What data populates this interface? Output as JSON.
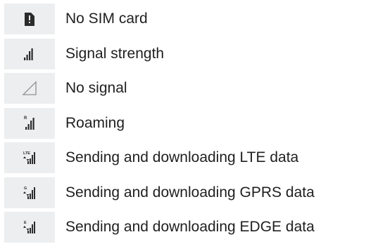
{
  "status_icons": [
    {
      "icon": "no-sim-card-icon",
      "label": "No SIM card"
    },
    {
      "icon": "signal-strength-icon",
      "label": "Signal strength"
    },
    {
      "icon": "no-signal-icon",
      "label": "No signal"
    },
    {
      "icon": "roaming-icon",
      "label": "Roaming",
      "badge": "R"
    },
    {
      "icon": "lte-data-icon",
      "label": "Sending and downloading LTE data",
      "badge": "LTE"
    },
    {
      "icon": "gprs-data-icon",
      "label": "Sending and downloading GPRS data",
      "badge": "G"
    },
    {
      "icon": "edge-data-icon",
      "label": "Sending and downloading EDGE data",
      "badge": "E"
    }
  ],
  "colors": {
    "icon_background": "#eceeef",
    "icon_foreground": "#2b2b2b",
    "text": "#1f1f1f"
  }
}
